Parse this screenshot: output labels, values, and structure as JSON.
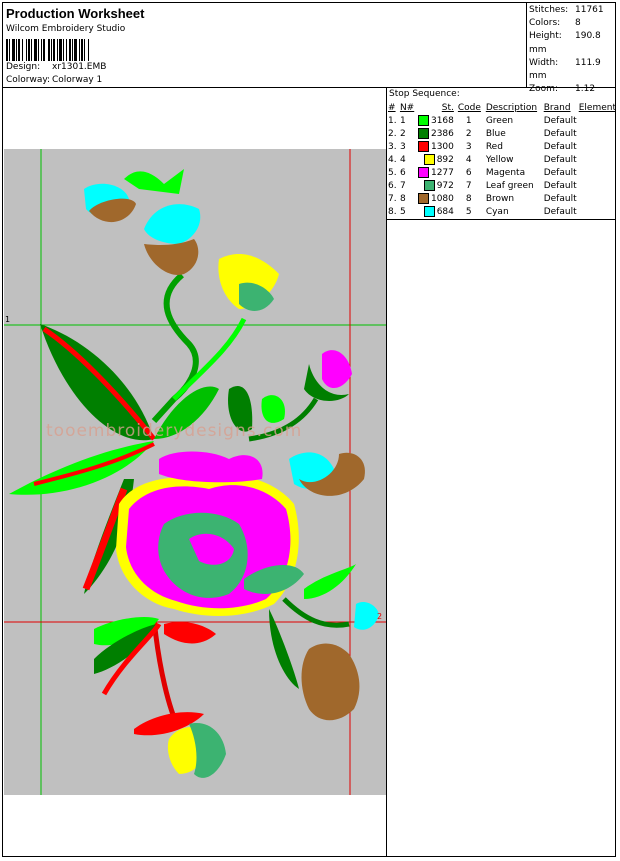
{
  "header": {
    "title": "Production Worksheet",
    "software": "Wilcom  Embroidery Studio",
    "design_label": "Design:",
    "design_value": "xr1301.EMB",
    "colorway_label": "Colorway:",
    "colorway_value": "Colorway 1"
  },
  "stats": {
    "stitches_label": "Stitches:",
    "stitches": "11761",
    "colors_label": "Colors:",
    "colors": "8",
    "height_label": "Height:",
    "height": "190.8 mm",
    "width_label": "Width:",
    "width": "111.9 mm",
    "zoom_label": "Zoom:",
    "zoom": "1.12"
  },
  "stop_sequence": {
    "title": "Stop Sequence:",
    "columns": [
      "#",
      "N#",
      "St.",
      "Code",
      "Description",
      "Brand",
      "Element"
    ],
    "rows": [
      {
        "num": "1.",
        "n": "1",
        "color": "#00ff00",
        "st": "3168",
        "code": "1",
        "desc": "Green",
        "brand": "Default"
      },
      {
        "num": "2.",
        "n": "2",
        "color": "#007f00",
        "st": "2386",
        "code": "2",
        "desc": "Blue",
        "brand": "Default"
      },
      {
        "num": "3.",
        "n": "3",
        "color": "#ff0000",
        "st": "1300",
        "code": "3",
        "desc": "Red",
        "brand": "Default"
      },
      {
        "num": "4.",
        "n": "4",
        "color": "#ffff00",
        "st": "892",
        "code": "4",
        "desc": "Yellow",
        "brand": "Default"
      },
      {
        "num": "5.",
        "n": "6",
        "color": "#ff00ff",
        "st": "1277",
        "code": "6",
        "desc": "Magenta",
        "brand": "Default"
      },
      {
        "num": "6.",
        "n": "7",
        "color": "#3cb371",
        "st": "972",
        "code": "7",
        "desc": "Leaf green",
        "brand": "Default"
      },
      {
        "num": "7.",
        "n": "8",
        "color": "#a0682c",
        "st": "1080",
        "code": "8",
        "desc": "Brown",
        "brand": "Default"
      },
      {
        "num": "8.",
        "n": "5",
        "color": "#00ffff",
        "st": "684",
        "code": "5",
        "desc": "Cyan",
        "brand": "Default"
      }
    ]
  },
  "design": {
    "background": "#c0c0c0",
    "marker_1": "1",
    "marker_2": "2"
  }
}
